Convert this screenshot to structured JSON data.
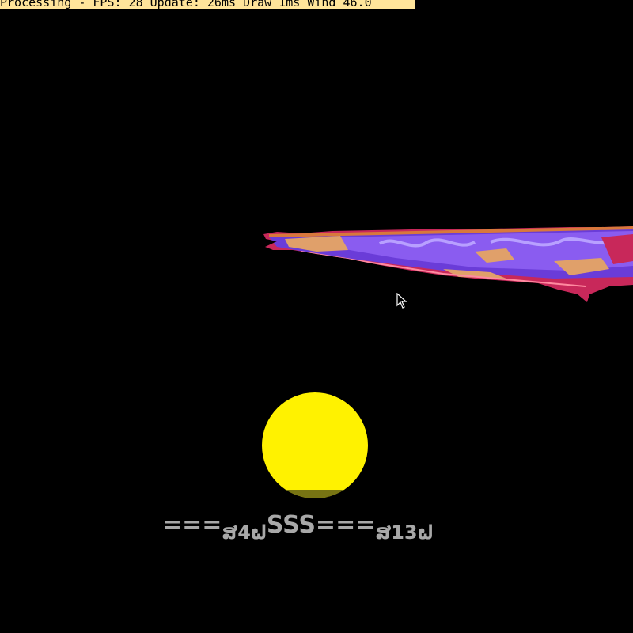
{
  "window": {
    "status_text": "Processing - FPS: 28 Update: 26ms Draw 1ms Wind 46.0"
  },
  "hud": {
    "segments": [
      {
        "text": "===",
        "style": "big"
      },
      {
        "text": "ສ4ຝ",
        "style": "small"
      },
      {
        "text": "SSS===",
        "style": "big"
      },
      {
        "text": "ສ13ຝ",
        "style": "small"
      }
    ]
  },
  "sprites": {
    "carpet": "flying-carpet",
    "sun": "sun-circle",
    "cursor": "mouse-pointer-icon"
  },
  "colors": {
    "background": "#000000",
    "status_bar": "#ffe49a",
    "sun": "#fff200",
    "hud_text": "#a8a8a8",
    "carpet_primary": "#6a3cd8",
    "carpet_accent": "#c8285a",
    "carpet_trim": "#e0a06a"
  }
}
